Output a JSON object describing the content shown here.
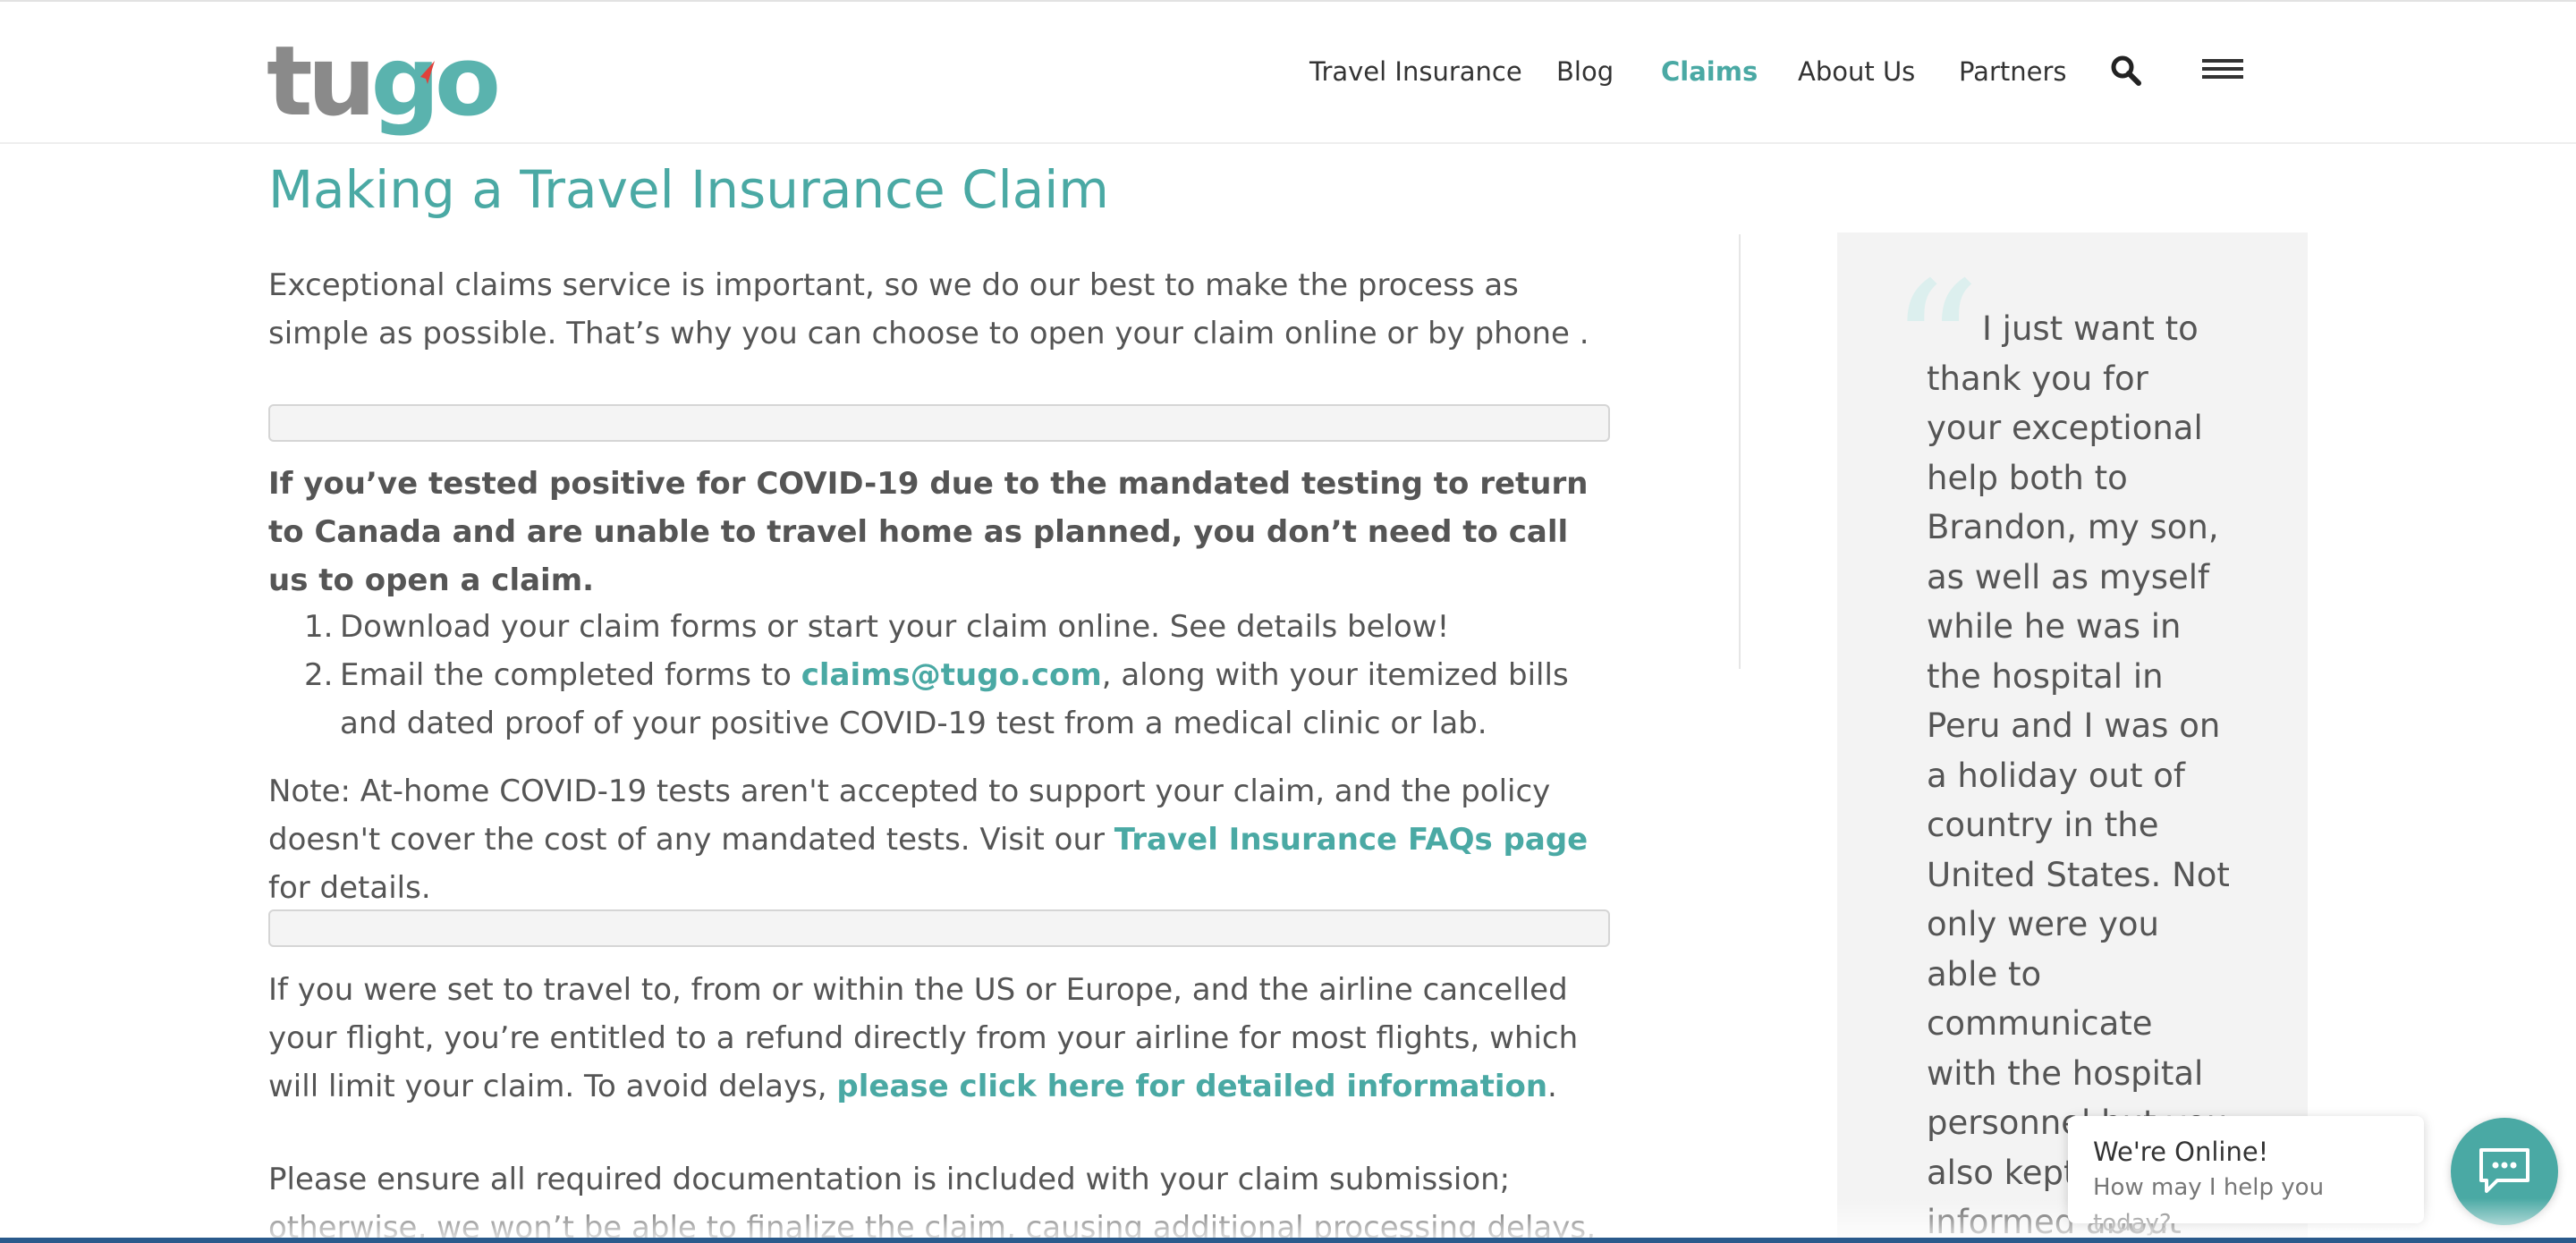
{
  "header": {
    "logo": "tugo",
    "nav": [
      {
        "label": "Travel Insurance"
      },
      {
        "label": "Blog"
      },
      {
        "label": "Claims"
      },
      {
        "label": "About Us"
      },
      {
        "label": "Partners"
      }
    ],
    "active_color": "#4aa9a4",
    "icons": [
      "search-icon",
      "hamburger-menu-icon"
    ]
  },
  "main": {
    "title": "Making a Travel Insurance Claim",
    "intro": "Exceptional claims service is important, so we do our best to make the process as simple as possible. That’s why you can choose to open your claim online or by phone .",
    "covid_notice": "If you’ve tested positive for COVID-19 due to the mandated testing to return to Canada and are unable to travel home as planned, you don’t need to call us to open a claim.",
    "steps": [
      {
        "num": "1.",
        "text": "Download your claim forms or start your claim online. See details below!"
      },
      {
        "num": "2.",
        "before": "Email the completed forms to ",
        "link": "claims@tugo.com",
        "after": ", along with your itemized bills and dated proof of your positive COVID-19 test from a medical clinic or lab."
      }
    ],
    "note": {
      "before": "Note: At-home COVID-19 tests aren't accepted to support your claim, and the policy doesn't cover the cost of any mandated tests. Visit our ",
      "link": "Travel Insurance FAQs page",
      "after": " for details."
    },
    "airline": {
      "before": "If you were set to travel to, from or within the US or Europe, and the airline cancelled your flight, you’re entitled to a refund directly from your airline for most flights, which will limit your claim. To avoid delays, ",
      "link": "please click here for detailed information",
      "after": "."
    },
    "documentation": "Please ensure all required documentation is included with your claim submission; otherwise, we won’t be able to finalize the claim, causing additional processing delays, since all"
  },
  "testimonial": {
    "quote_mark": "“",
    "text": "I just want to thank you for your exceptional help both to Brandon, my son, as well as myself while he was in the hospital in Peru and I was on a holiday out of country in the United States. Not only were you able to communicate with the hospital personnel but you also kept me informed about"
  },
  "chat": {
    "title": "We're Online!",
    "subtitle": "How may I help you today?",
    "icon": "chat-icon"
  }
}
